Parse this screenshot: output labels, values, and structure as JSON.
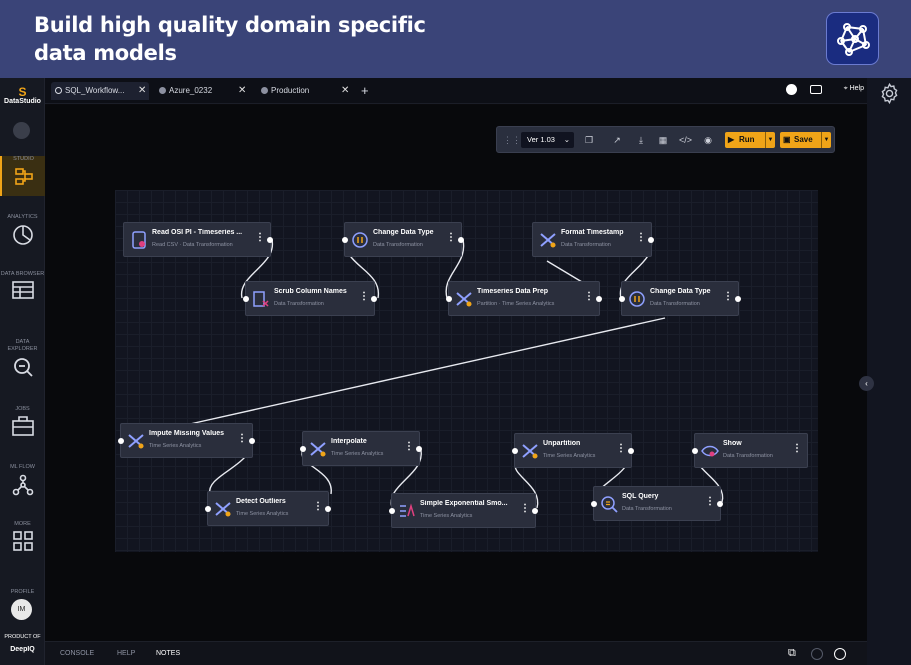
{
  "banner": {
    "title": "Build high quality domain specific data models"
  },
  "sidebar": {
    "logo": "DataStudio",
    "items": [
      {
        "label": "STUDIO"
      },
      {
        "label": "ANALYTICS"
      },
      {
        "label": "DATA BROWSER"
      },
      {
        "label": "DATA EXPLORER"
      },
      {
        "label": "JOBS"
      },
      {
        "label": "ML FLOW"
      },
      {
        "label": "MORE"
      },
      {
        "label": "PROFILE"
      }
    ],
    "avatar": "IM",
    "product_of": "PRODUCT OF",
    "brand": "DeepIQ"
  },
  "tabs": [
    {
      "label": "SQL_Workflow..."
    },
    {
      "label": "Azure_0232"
    },
    {
      "label": "Production"
    }
  ],
  "topbar": {
    "help": "Help"
  },
  "toolbar": {
    "version": "Ver 1.03",
    "run": "Run",
    "save": "Save"
  },
  "nodes": [
    {
      "title": "Read OSI PI - Timeseries ...",
      "sub": "Read CSV · Data Transformation"
    },
    {
      "title": "Scrub Column Names",
      "sub": "Data Transformation"
    },
    {
      "title": "Change Data Type",
      "sub": "Data Transformation"
    },
    {
      "title": "Timeseries Data Prep",
      "sub": "Partition · Time Series Analytics"
    },
    {
      "title": "Format Timestamp",
      "sub": "Data Transformation"
    },
    {
      "title": "Change Data Type",
      "sub": "Data Transformation"
    },
    {
      "title": "Impute Missing Values",
      "sub": "Time Series Analytics"
    },
    {
      "title": "Detect Outliers",
      "sub": "Time Series Analytics"
    },
    {
      "title": "Interpolate",
      "sub": "Time Series Analytics"
    },
    {
      "title": "Simple Exponential Smo...",
      "sub": "Time Series Analytics"
    },
    {
      "title": "Unpartition",
      "sub": "Time Series Analytics"
    },
    {
      "title": "SQL Query",
      "sub": "Data Transformation"
    },
    {
      "title": "Show",
      "sub": "Data Transformation"
    }
  ],
  "bottom": {
    "console": "CONSOLE",
    "help": "HELP",
    "notes": "NOTES"
  },
  "colors": {
    "accent": "#f0a418",
    "banner": "#3a4478",
    "canvas": "#121520"
  }
}
